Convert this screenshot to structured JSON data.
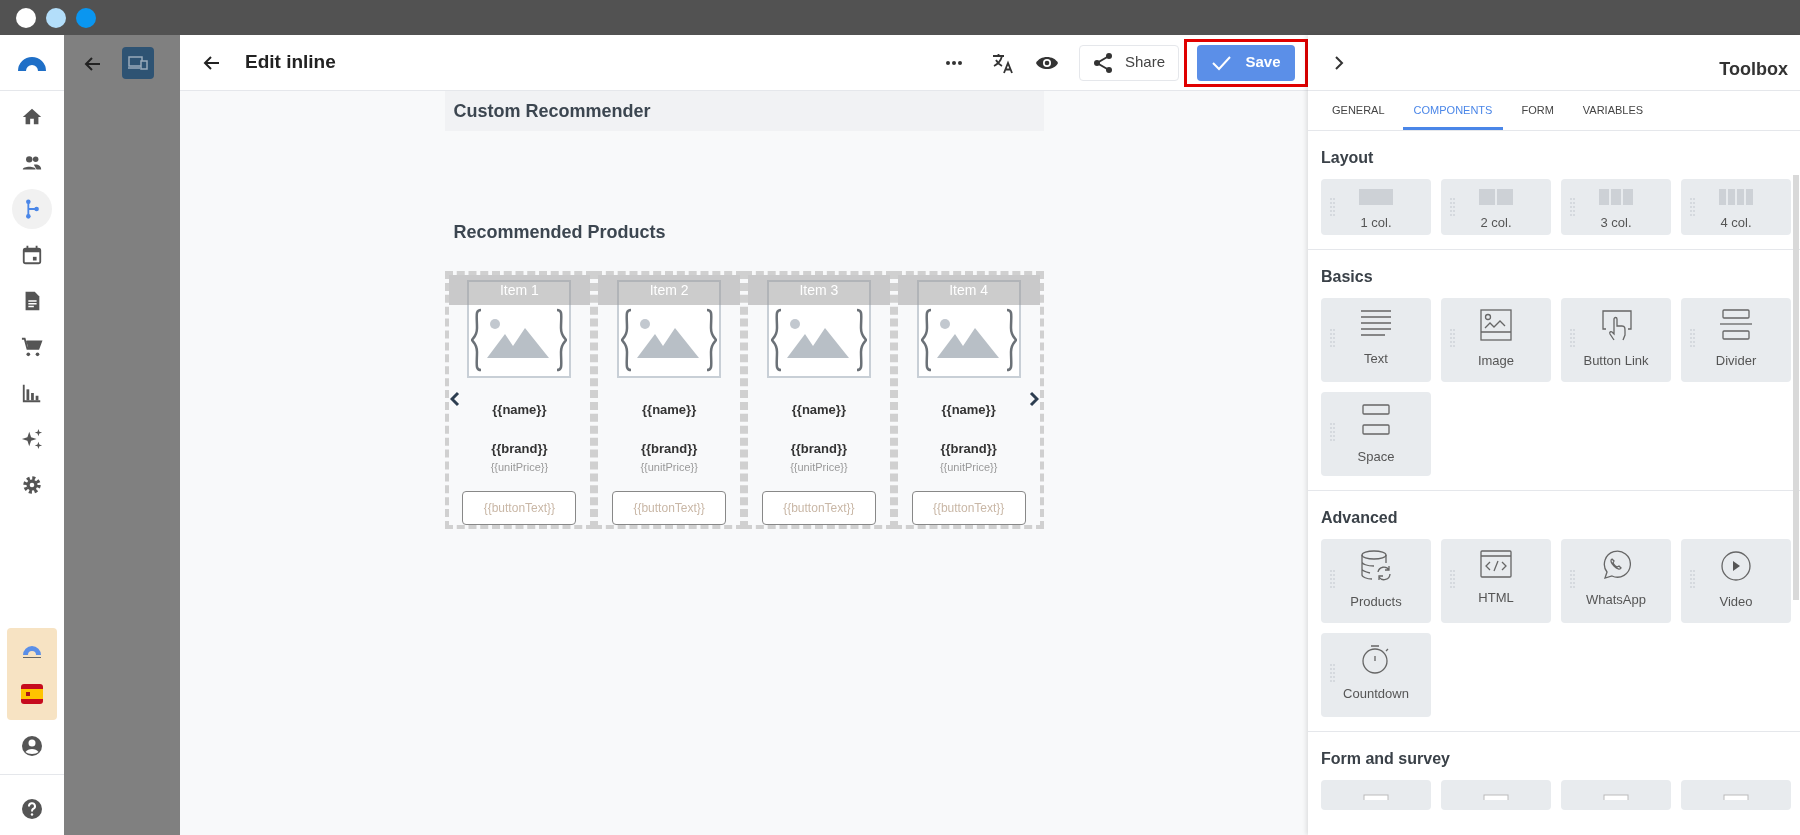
{
  "nav": {
    "items": [
      {
        "kind": "home",
        "selected": false
      },
      {
        "kind": "people",
        "selected": false
      },
      {
        "kind": "flow",
        "selected": true
      },
      {
        "kind": "calendar",
        "selected": false
      },
      {
        "kind": "document",
        "selected": false
      },
      {
        "kind": "cart",
        "selected": false
      },
      {
        "kind": "chart",
        "selected": false
      },
      {
        "kind": "sparkle",
        "selected": false
      },
      {
        "kind": "gear",
        "selected": false
      }
    ]
  },
  "editor": {
    "title": "Edit inline",
    "share": "Share",
    "save": "Save",
    "toolbox_title": "Toolbox"
  },
  "canvas": {
    "block_title": "Custom Recommender",
    "heading": "Recommended Products",
    "items": [
      {
        "label": "Item 1",
        "name": "{{name}}",
        "brand": "{{brand}}",
        "price": "{{unitPrice}}",
        "button": "{{buttonText}}"
      },
      {
        "label": "Item 2",
        "name": "{{name}}",
        "brand": "{{brand}}",
        "price": "{{unitPrice}}",
        "button": "{{buttonText}}"
      },
      {
        "label": "Item 3",
        "name": "{{name}}",
        "brand": "{{brand}}",
        "price": "{{unitPrice}}",
        "button": "{{buttonText}}"
      },
      {
        "label": "Item 4",
        "name": "{{name}}",
        "brand": "{{brand}}",
        "price": "{{unitPrice}}",
        "button": "{{buttonText}}"
      }
    ]
  },
  "toolbox": {
    "tabs": [
      {
        "label": "GENERAL",
        "selected": false
      },
      {
        "label": "COMPONENTS",
        "selected": true
      },
      {
        "label": "FORM",
        "selected": false
      },
      {
        "label": "VARIABLES",
        "selected": false
      }
    ],
    "sections": [
      {
        "heading": "Layout",
        "items": [
          {
            "label": "1 col.",
            "kind": "col1"
          },
          {
            "label": "2 col.",
            "kind": "col2"
          },
          {
            "label": "3 col.",
            "kind": "col3"
          },
          {
            "label": "4 col.",
            "kind": "col4"
          }
        ]
      },
      {
        "heading": "Basics",
        "items": [
          {
            "label": "Text",
            "kind": "text"
          },
          {
            "label": "Image",
            "kind": "image"
          },
          {
            "label": "Button Link",
            "kind": "button"
          },
          {
            "label": "Divider",
            "kind": "divider"
          },
          {
            "label": "Space",
            "kind": "space"
          }
        ]
      },
      {
        "heading": "Advanced",
        "items": [
          {
            "label": "Products",
            "kind": "products"
          },
          {
            "label": "HTML",
            "kind": "html"
          },
          {
            "label": "WhatsApp",
            "kind": "whatsapp"
          },
          {
            "label": "Video",
            "kind": "video"
          },
          {
            "label": "Countdown",
            "kind": "countdown"
          }
        ]
      },
      {
        "heading": "Form and survey",
        "items": [
          {
            "kind": "field"
          },
          {
            "kind": "field"
          },
          {
            "kind": "field"
          },
          {
            "kind": "field"
          }
        ]
      }
    ]
  }
}
